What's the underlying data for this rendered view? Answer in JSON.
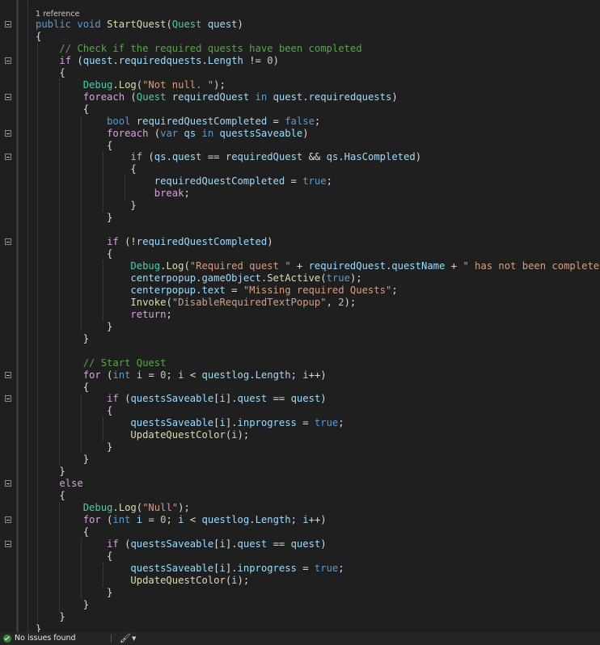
{
  "codelens": {
    "references": "1 reference"
  },
  "code_lines": [
    [
      [
        "public",
        "kw"
      ],
      [
        " ",
        "pn"
      ],
      [
        "void",
        "kw"
      ],
      [
        " ",
        "pn"
      ],
      [
        "StartQuest",
        "fn"
      ],
      [
        "(",
        "pn"
      ],
      [
        "Quest",
        "ty"
      ],
      [
        " ",
        "pn"
      ],
      [
        "quest",
        "var"
      ],
      [
        ")",
        "pn"
      ]
    ],
    [
      [
        "{",
        "pn"
      ]
    ],
    [
      [
        "    ",
        "pn"
      ],
      [
        "// Check if the required quests have been completed",
        "cm"
      ]
    ],
    [
      [
        "    ",
        "pn"
      ],
      [
        "if",
        "ctl"
      ],
      [
        " (",
        "pn"
      ],
      [
        "quest",
        "var"
      ],
      [
        ".",
        "pn"
      ],
      [
        "requiredquests",
        "var"
      ],
      [
        ".",
        "pn"
      ],
      [
        "Length",
        "var"
      ],
      [
        " != ",
        "pn"
      ],
      [
        "0",
        "num"
      ],
      [
        ")",
        "pn"
      ]
    ],
    [
      [
        "    {",
        "pn"
      ]
    ],
    [
      [
        "        ",
        "pn"
      ],
      [
        "Debug",
        "ty"
      ],
      [
        ".",
        "pn"
      ],
      [
        "Log",
        "fn"
      ],
      [
        "(",
        "pn"
      ],
      [
        "\"Not null. \"",
        "str"
      ],
      [
        ");",
        "pn"
      ]
    ],
    [
      [
        "        ",
        "pn"
      ],
      [
        "foreach",
        "ctl"
      ],
      [
        " (",
        "pn"
      ],
      [
        "Quest",
        "ty"
      ],
      [
        " ",
        "pn"
      ],
      [
        "requiredQuest",
        "var"
      ],
      [
        " ",
        "pn"
      ],
      [
        "in",
        "kw"
      ],
      [
        " ",
        "pn"
      ],
      [
        "quest",
        "var"
      ],
      [
        ".",
        "pn"
      ],
      [
        "requiredquests",
        "var"
      ],
      [
        ")",
        "pn"
      ]
    ],
    [
      [
        "        {",
        "pn"
      ]
    ],
    [
      [
        "            ",
        "pn"
      ],
      [
        "bool",
        "kw"
      ],
      [
        " ",
        "pn"
      ],
      [
        "requiredQuestCompleted",
        "var"
      ],
      [
        " = ",
        "pn"
      ],
      [
        "false",
        "kw"
      ],
      [
        ";",
        "pn"
      ]
    ],
    [
      [
        "            ",
        "pn"
      ],
      [
        "foreach",
        "ctl"
      ],
      [
        " (",
        "pn"
      ],
      [
        "var",
        "kw"
      ],
      [
        " ",
        "pn"
      ],
      [
        "qs",
        "var"
      ],
      [
        " ",
        "pn"
      ],
      [
        "in",
        "kw"
      ],
      [
        " ",
        "pn"
      ],
      [
        "questsSaveable",
        "var"
      ],
      [
        ")",
        "pn"
      ]
    ],
    [
      [
        "            {",
        "pn"
      ]
    ],
    [
      [
        "                ",
        "pn"
      ],
      [
        "if",
        "ctl"
      ],
      [
        " (",
        "pn"
      ],
      [
        "qs",
        "var"
      ],
      [
        ".",
        "pn"
      ],
      [
        "quest",
        "var"
      ],
      [
        " == ",
        "pn"
      ],
      [
        "requiredQuest",
        "var"
      ],
      [
        " && ",
        "pn"
      ],
      [
        "qs",
        "var"
      ],
      [
        ".",
        "pn"
      ],
      [
        "HasCompleted",
        "var"
      ],
      [
        ")",
        "pn"
      ]
    ],
    [
      [
        "                {",
        "pn"
      ]
    ],
    [
      [
        "                    ",
        "pn"
      ],
      [
        "requiredQuestCompleted",
        "var"
      ],
      [
        " = ",
        "pn"
      ],
      [
        "true",
        "kw"
      ],
      [
        ";",
        "pn"
      ]
    ],
    [
      [
        "                    ",
        "pn"
      ],
      [
        "break",
        "ctl"
      ],
      [
        ";",
        "pn"
      ]
    ],
    [
      [
        "                }",
        "pn"
      ]
    ],
    [
      [
        "            }",
        "pn"
      ]
    ],
    [],
    [
      [
        "            ",
        "pn"
      ],
      [
        "if",
        "ctl"
      ],
      [
        " (!",
        "pn"
      ],
      [
        "requiredQuestCompleted",
        "var"
      ],
      [
        ")",
        "pn"
      ]
    ],
    [
      [
        "            {",
        "pn"
      ]
    ],
    [
      [
        "                ",
        "pn"
      ],
      [
        "Debug",
        "ty"
      ],
      [
        ".",
        "pn"
      ],
      [
        "Log",
        "fn"
      ],
      [
        "(",
        "pn"
      ],
      [
        "\"Required quest \"",
        "str"
      ],
      [
        " + ",
        "pn"
      ],
      [
        "requiredQuest",
        "var"
      ],
      [
        ".",
        "pn"
      ],
      [
        "questName",
        "var"
      ],
      [
        " + ",
        "pn"
      ],
      [
        "\" has not been completed.\"",
        "str"
      ],
      [
        ");",
        "pn"
      ]
    ],
    [
      [
        "                ",
        "pn"
      ],
      [
        "centerpopup",
        "var"
      ],
      [
        ".",
        "pn"
      ],
      [
        "gameObject",
        "var"
      ],
      [
        ".",
        "pn"
      ],
      [
        "SetActive",
        "fn"
      ],
      [
        "(",
        "pn"
      ],
      [
        "true",
        "kw"
      ],
      [
        ");",
        "pn"
      ]
    ],
    [
      [
        "                ",
        "pn"
      ],
      [
        "centerpopup",
        "var"
      ],
      [
        ".",
        "pn"
      ],
      [
        "text",
        "var"
      ],
      [
        " = ",
        "pn"
      ],
      [
        "\"Missing required Quests\"",
        "str"
      ],
      [
        ";",
        "pn"
      ]
    ],
    [
      [
        "                ",
        "pn"
      ],
      [
        "Invoke",
        "fn"
      ],
      [
        "(",
        "pn"
      ],
      [
        "\"DisableRequiredTextPopup\"",
        "str"
      ],
      [
        ", ",
        "pn"
      ],
      [
        "2",
        "num"
      ],
      [
        ");",
        "pn"
      ]
    ],
    [
      [
        "                ",
        "pn"
      ],
      [
        "return",
        "ctl"
      ],
      [
        ";",
        "pn"
      ]
    ],
    [
      [
        "            }",
        "pn"
      ]
    ],
    [
      [
        "        }",
        "pn"
      ]
    ],
    [],
    [
      [
        "        ",
        "pn"
      ],
      [
        "// Start Quest",
        "cm"
      ]
    ],
    [
      [
        "        ",
        "pn"
      ],
      [
        "for",
        "ctl"
      ],
      [
        " (",
        "pn"
      ],
      [
        "int",
        "kw"
      ],
      [
        " ",
        "pn"
      ],
      [
        "i",
        "var"
      ],
      [
        " = ",
        "pn"
      ],
      [
        "0",
        "num"
      ],
      [
        "; ",
        "pn"
      ],
      [
        "i",
        "var"
      ],
      [
        " < ",
        "pn"
      ],
      [
        "questlog",
        "var"
      ],
      [
        ".",
        "pn"
      ],
      [
        "Length",
        "var"
      ],
      [
        "; ",
        "pn"
      ],
      [
        "i",
        "var"
      ],
      [
        "++)",
        "pn"
      ]
    ],
    [
      [
        "        {",
        "pn"
      ]
    ],
    [
      [
        "            ",
        "pn"
      ],
      [
        "if",
        "ctl"
      ],
      [
        " (",
        "pn"
      ],
      [
        "questsSaveable",
        "var"
      ],
      [
        "[",
        "pn"
      ],
      [
        "i",
        "var"
      ],
      [
        "].",
        "pn"
      ],
      [
        "quest",
        "var"
      ],
      [
        " == ",
        "pn"
      ],
      [
        "quest",
        "var"
      ],
      [
        ")",
        "pn"
      ]
    ],
    [
      [
        "            {",
        "pn"
      ]
    ],
    [
      [
        "                ",
        "pn"
      ],
      [
        "questsSaveable",
        "var"
      ],
      [
        "[",
        "pn"
      ],
      [
        "i",
        "var"
      ],
      [
        "].",
        "pn"
      ],
      [
        "inprogress",
        "var"
      ],
      [
        " = ",
        "pn"
      ],
      [
        "true",
        "kw"
      ],
      [
        ";",
        "pn"
      ]
    ],
    [
      [
        "                ",
        "pn"
      ],
      [
        "UpdateQuestColor",
        "fn"
      ],
      [
        "(",
        "pn"
      ],
      [
        "i",
        "var"
      ],
      [
        ");",
        "pn"
      ]
    ],
    [
      [
        "            }",
        "pn"
      ]
    ],
    [
      [
        "        }",
        "pn"
      ]
    ],
    [
      [
        "    }",
        "pn"
      ]
    ],
    [
      [
        "    ",
        "pn"
      ],
      [
        "else",
        "ctl"
      ]
    ],
    [
      [
        "    {",
        "pn"
      ]
    ],
    [
      [
        "        ",
        "pn"
      ],
      [
        "Debug",
        "ty"
      ],
      [
        ".",
        "pn"
      ],
      [
        "Log",
        "fn"
      ],
      [
        "(",
        "pn"
      ],
      [
        "\"Null\"",
        "str"
      ],
      [
        ");",
        "pn"
      ]
    ],
    [
      [
        "        ",
        "pn"
      ],
      [
        "for",
        "ctl"
      ],
      [
        " (",
        "pn"
      ],
      [
        "int",
        "kw"
      ],
      [
        " ",
        "pn"
      ],
      [
        "i",
        "var"
      ],
      [
        " = ",
        "pn"
      ],
      [
        "0",
        "num"
      ],
      [
        "; ",
        "pn"
      ],
      [
        "i",
        "var"
      ],
      [
        " < ",
        "pn"
      ],
      [
        "questlog",
        "var"
      ],
      [
        ".",
        "pn"
      ],
      [
        "Length",
        "var"
      ],
      [
        "; ",
        "pn"
      ],
      [
        "i",
        "var"
      ],
      [
        "++)",
        "pn"
      ]
    ],
    [
      [
        "        {",
        "pn"
      ]
    ],
    [
      [
        "            ",
        "pn"
      ],
      [
        "if",
        "ctl"
      ],
      [
        " (",
        "pn"
      ],
      [
        "questsSaveable",
        "var"
      ],
      [
        "[",
        "pn"
      ],
      [
        "i",
        "var"
      ],
      [
        "].",
        "pn"
      ],
      [
        "quest",
        "var"
      ],
      [
        " == ",
        "pn"
      ],
      [
        "quest",
        "var"
      ],
      [
        ")",
        "pn"
      ]
    ],
    [
      [
        "            {",
        "pn"
      ]
    ],
    [
      [
        "                ",
        "pn"
      ],
      [
        "questsSaveable",
        "var"
      ],
      [
        "[",
        "pn"
      ],
      [
        "i",
        "var"
      ],
      [
        "].",
        "pn"
      ],
      [
        "inprogress",
        "var"
      ],
      [
        " = ",
        "pn"
      ],
      [
        "true",
        "kw"
      ],
      [
        ";",
        "pn"
      ]
    ],
    [
      [
        "                ",
        "pn"
      ],
      [
        "UpdateQuestColor",
        "fn"
      ],
      [
        "(",
        "pn"
      ],
      [
        "i",
        "var"
      ],
      [
        ");",
        "pn"
      ]
    ],
    [
      [
        "            }",
        "pn"
      ]
    ],
    [
      [
        "        }",
        "pn"
      ]
    ],
    [
      [
        "    }",
        "pn"
      ]
    ],
    [
      [
        "}",
        "pn"
      ]
    ]
  ],
  "fold_lines": [
    0,
    3,
    6,
    9,
    11,
    18,
    29,
    31,
    38,
    41,
    43
  ],
  "status": {
    "issues_text": "No issues found",
    "check_icon": "check-circle-icon",
    "brush_icon": "code-cleanup-brush-icon",
    "dropdown_icon": "chevron-down-icon"
  },
  "colors": {
    "background": "#1f1f1f",
    "keyword": "#569cd6",
    "control_keyword": "#d8a0df",
    "type": "#4ec9b0",
    "variable": "#9cdcfe",
    "method": "#dcdcaa",
    "string": "#d69d85",
    "number": "#b5cea8",
    "comment": "#57a64a",
    "status_ok": "#388a34"
  }
}
